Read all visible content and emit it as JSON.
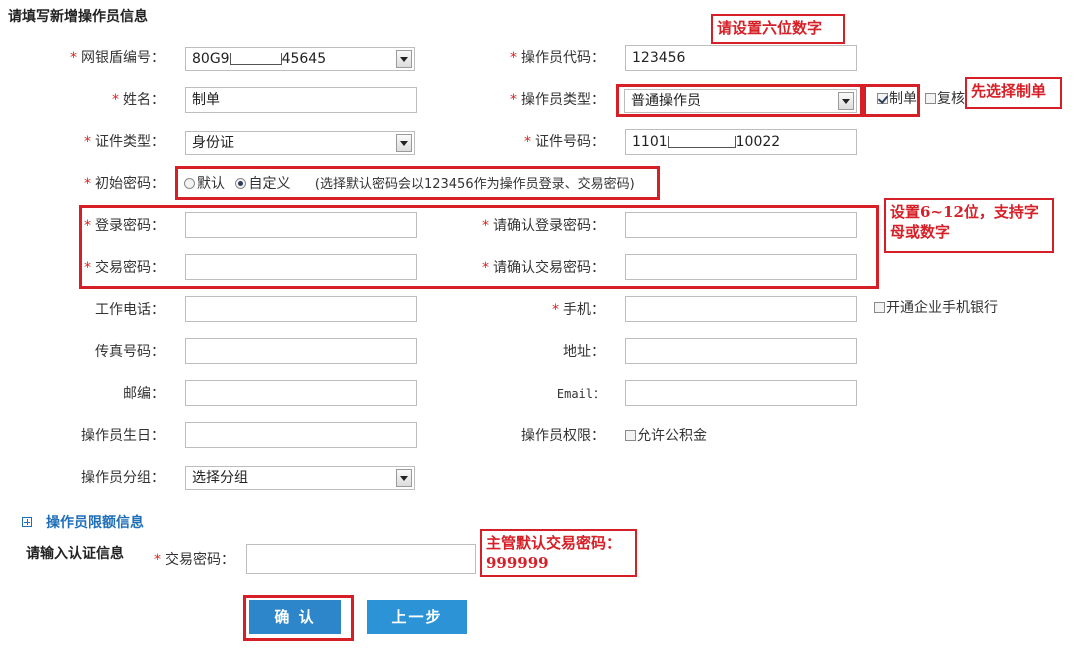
{
  "page_title": "请填写新增操作员信息",
  "required_mark": "*",
  "fields": {
    "usbkey_no": {
      "label": "网银盾编号：",
      "value_prefix": "80G9",
      "value_suffix": "45645"
    },
    "operator_code": {
      "label": "操作员代码：",
      "value": "123456"
    },
    "name": {
      "label": "姓名：",
      "value": "制单"
    },
    "operator_type": {
      "label": "操作员类型：",
      "value": "普通操作员"
    },
    "role_maker": {
      "label": "制单",
      "checked": true
    },
    "role_checker": {
      "label": "复核",
      "checked": false
    },
    "id_type": {
      "label": "证件类型：",
      "value": "身份证"
    },
    "id_number": {
      "label": "证件号码：",
      "value_prefix": "1101",
      "value_suffix": "10022"
    },
    "init_password": {
      "label": "初始密码：",
      "option_default": "默认",
      "option_custom": "自定义",
      "selected": "自定义",
      "hint": "(选择默认密码会以123456作为操作员登录、交易密码)"
    },
    "login_password": {
      "label": "登录密码：",
      "value": ""
    },
    "login_password_confirm": {
      "label": "请确认登录密码：",
      "value": ""
    },
    "trade_password": {
      "label": "交易密码：",
      "value": ""
    },
    "trade_password_confirm": {
      "label": "请确认交易密码：",
      "value": ""
    },
    "work_phone": {
      "label": "工作电话：",
      "value": ""
    },
    "mobile": {
      "label": "手机：",
      "value": ""
    },
    "mobile_banking": {
      "label": "开通企业手机银行",
      "checked": false
    },
    "fax": {
      "label": "传真号码：",
      "value": ""
    },
    "address": {
      "label": "地址：",
      "value": ""
    },
    "postcode": {
      "label": "邮编：",
      "value": ""
    },
    "email": {
      "label": "Email：",
      "value": ""
    },
    "birthday": {
      "label": "操作员生日：",
      "value": ""
    },
    "permission": {
      "label": "操作员权限：",
      "option_label": "允许公积金",
      "checked": false
    },
    "group": {
      "label": "操作员分组：",
      "value": "选择分组"
    }
  },
  "limit_section": {
    "label": "操作员限额信息"
  },
  "auth_section": {
    "title": "请输入认证信息",
    "trade_password_label": "交易密码：",
    "trade_password_value": ""
  },
  "buttons": {
    "confirm": "确 认",
    "back": "上一步"
  },
  "annotations": {
    "six_digits": "请设置六位数字",
    "choose_maker": "先选择制单",
    "password_rule": "设置6~12位，支持字母或数字",
    "supervisor_password": "主管默认交易密码：999999"
  },
  "colors": {
    "accent": "#2c86c9",
    "required": "#e02020",
    "annotation": "#d61f26",
    "link": "#1f6fb8"
  }
}
